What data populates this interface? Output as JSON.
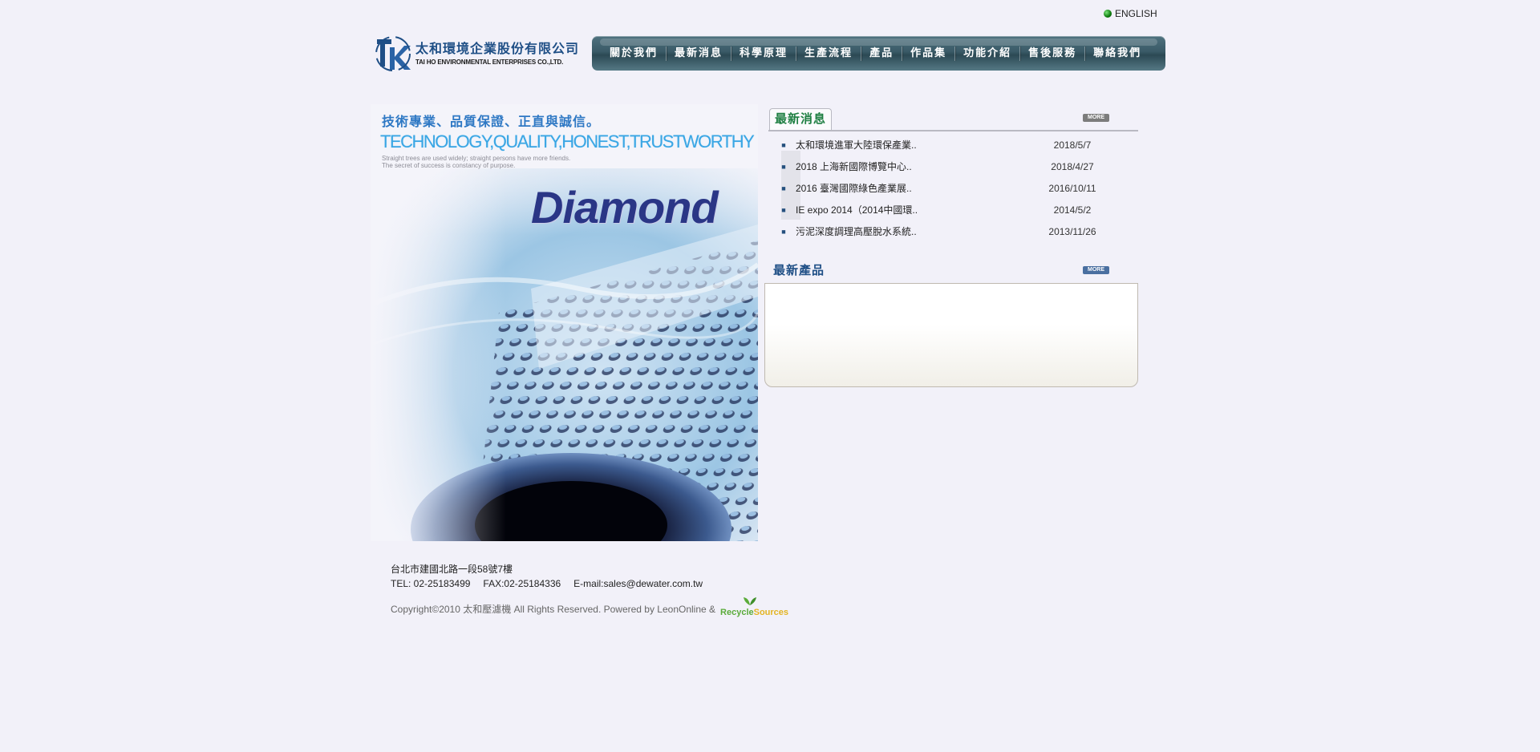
{
  "header": {
    "language_link": "ENGLISH",
    "company_name_cn": "太和環境企業股份有限公司",
    "company_name_en": "TAI HO ENVIRONMENTAL ENTERPRISES CO.,LTD."
  },
  "nav": {
    "items": [
      {
        "label": "關於我們"
      },
      {
        "label": "最新消息"
      },
      {
        "label": "科學原理"
      },
      {
        "label": "生產流程"
      },
      {
        "label": "產品"
      },
      {
        "label": "作品集"
      },
      {
        "label": "功能介紹"
      },
      {
        "label": "售後服務"
      },
      {
        "label": "聯絡我們"
      }
    ]
  },
  "hero": {
    "slogan": "技術專業、品質保證、正直與誠信。",
    "tagline": "TECHNOLOGY,QUALITY,HONEST,TRUSTWORTHY",
    "subtext_1": "Straight trees are used widely; straight persons have more friends.",
    "subtext_2": "The secret of success is constancy of purpose.",
    "brand": "Diamond"
  },
  "news": {
    "title": "最新消息",
    "more_label": "MORE",
    "items": [
      {
        "title": "太和環境進軍大陸環保產業..",
        "date": "2018/5/7"
      },
      {
        "title": "2018 上海新國際博覽中心..",
        "date": "2018/4/27"
      },
      {
        "title": "2016 臺灣國際綠色產業展..",
        "date": "2016/10/11"
      },
      {
        "title": "IE expo 2014（2014中國環..",
        "date": "2014/5/2"
      },
      {
        "title": "污泥深度調理高壓脫水系統..",
        "date": "2013/11/26"
      }
    ]
  },
  "products": {
    "title": "最新產品",
    "more_label": "MORE"
  },
  "footer": {
    "address": "台北市建國北路一段58號7樓",
    "tel": "TEL: 02-25183499",
    "fax": "FAX:02-25184336",
    "email": "E-mail:sales@dewater.com.tw",
    "copyright": "Copyright©2010 太和壓濾機 All Rights Reserved. Powered by LeonOnline &",
    "partner_logo_a": "Recycle",
    "partner_logo_b": "Sources"
  },
  "colors": {
    "background": "#f2f1f9",
    "nav_bar": "#3a5a67",
    "brand_blue": "#1f4f86",
    "news_green": "#1e7f42"
  },
  "icons": {
    "language": "green-dot-icon",
    "logo": "tk-logo-icon",
    "bullet": "square-bullet-icon",
    "partner": "leaf-icon"
  }
}
